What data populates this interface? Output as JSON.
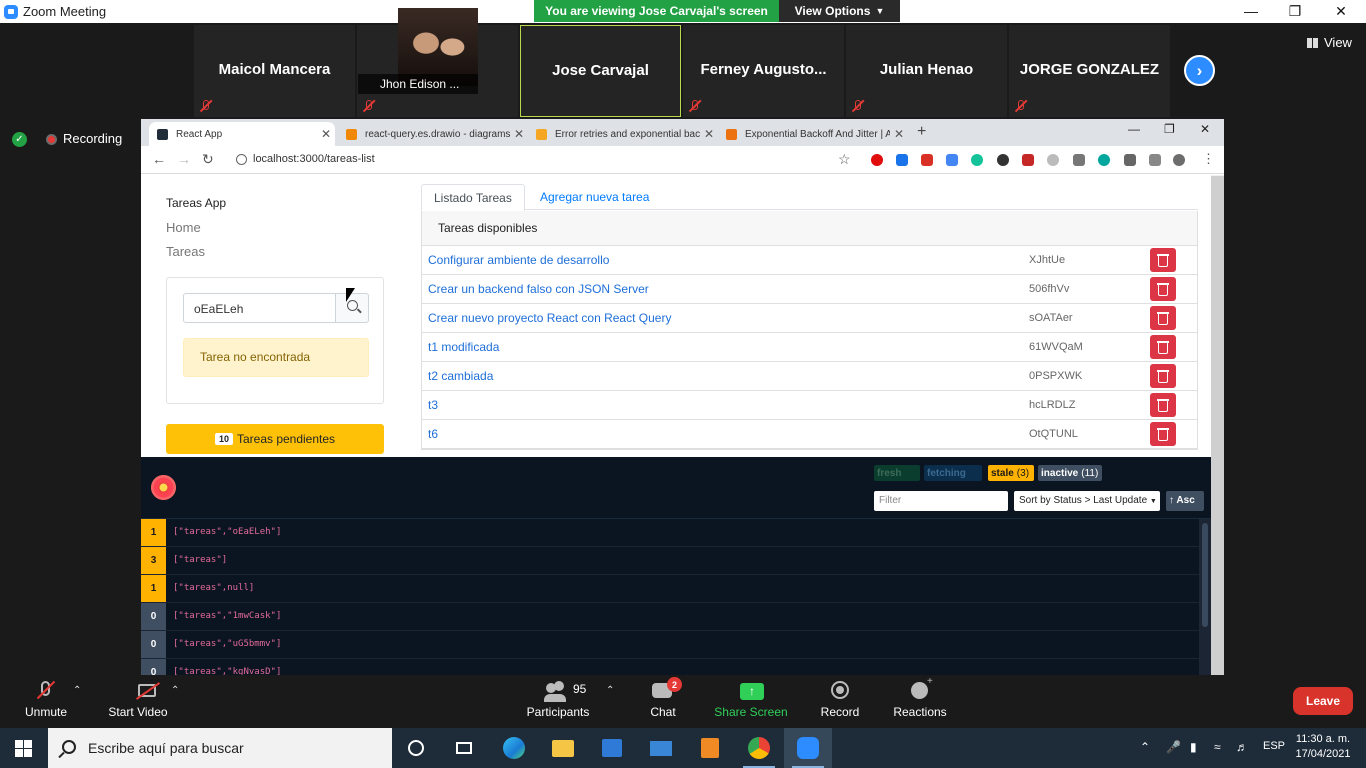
{
  "zoom": {
    "window_title": "Zoom Meeting",
    "banner": "You are viewing Jose Carvajal's screen",
    "view_options": "View Options",
    "view_button": "View",
    "recording": "Recording",
    "participants": [
      {
        "name": "Maicol Mancera",
        "muted": true
      },
      {
        "name": "Jhon Edison ...",
        "muted": true,
        "has_photo": true
      },
      {
        "name": "Jose Carvajal",
        "muted": false,
        "active": true
      },
      {
        "name": "Ferney  Augusto...",
        "muted": true
      },
      {
        "name": "Julian Henao",
        "muted": true
      },
      {
        "name": "JORGE GONZALEZ",
        "muted": true
      }
    ],
    "controls": {
      "unmute": "Unmute",
      "start_video": "Start Video",
      "participants": "Participants",
      "participants_count": "95",
      "chat": "Chat",
      "chat_badge": "2",
      "share_screen": "Share Screen",
      "record": "Record",
      "reactions": "Reactions",
      "leave": "Leave"
    }
  },
  "browser": {
    "tabs": [
      {
        "title": "React App",
        "active": true,
        "icon_color": "#222d3a"
      },
      {
        "title": "react-query.es.drawio - diagrams",
        "active": false,
        "icon_color": "#f08705"
      },
      {
        "title": "Error retries and exponential bac",
        "active": false,
        "icon_color": "#f5a623"
      },
      {
        "title": "Exponential Backoff And Jitter | A",
        "active": false,
        "icon_color": "#ec7211"
      }
    ],
    "url": "localhost:3000/tareas-list"
  },
  "app": {
    "brand": "Tareas App",
    "nav": [
      "Home",
      "Tareas"
    ],
    "search_value": "oEaELeh",
    "alert": "Tarea no encontrada",
    "pending_count": "10",
    "pending_label": "Tareas pendientes",
    "tab_list": "Listado Tareas",
    "tab_add": "Agregar nueva tarea",
    "list_header": "Tareas disponibles",
    "tasks": [
      {
        "title": "Configurar ambiente de desarrollo",
        "id": "XJhtUe"
      },
      {
        "title": "Crear un backend falso con JSON Server",
        "id": "506fhVv"
      },
      {
        "title": "Crear nuevo proyecto React con React Query",
        "id": "sOATAer"
      },
      {
        "title": "t1 modificada",
        "id": "61WVQaM"
      },
      {
        "title": "t2 cambiada",
        "id": "0PSPXWK"
      },
      {
        "title": "t3",
        "id": "hcLRDLZ"
      },
      {
        "title": "t6",
        "id": "OtQTUNL"
      }
    ]
  },
  "devtools": {
    "chips": [
      {
        "label": "fresh",
        "count": "",
        "bg": "#0b3d2e",
        "fg": "#3d6b5a"
      },
      {
        "label": "fetching",
        "count": "",
        "bg": "#0b2e4d",
        "fg": "#3a6a90"
      },
      {
        "label": "stale",
        "count": "(3)",
        "bg": "#ffb200",
        "fg": "#1a1a1a"
      },
      {
        "label": "inactive",
        "count": "(11)",
        "bg": "#3f4e60",
        "fg": "#ffffff"
      }
    ],
    "filter_placeholder": "Filter",
    "sort": "Sort by Status > Last Update",
    "asc": "↑ Asc",
    "queries": [
      {
        "count": "1",
        "key": "[\"tareas\",\"oEaELeh\"]",
        "status": "stale"
      },
      {
        "count": "3",
        "key": "[\"tareas\"]",
        "status": "stale"
      },
      {
        "count": "1",
        "key": "[\"tareas\",null]",
        "status": "stale"
      },
      {
        "count": "0",
        "key": "[\"tareas\",\"1mwCask\"]",
        "status": "inactive"
      },
      {
        "count": "0",
        "key": "[\"tareas\",\"uG5bmmv\"]",
        "status": "inactive"
      },
      {
        "count": "0",
        "key": "[\"tareas\",\"kgNvasD\"]",
        "status": "inactive"
      }
    ],
    "colors": {
      "stale": "#ffb200",
      "inactive": "#3f4e60"
    }
  },
  "taskbar": {
    "search_placeholder": "Escribe aquí para buscar",
    "lang": "ESP",
    "time": "11:30 a. m.",
    "date": "17/04/2021"
  }
}
